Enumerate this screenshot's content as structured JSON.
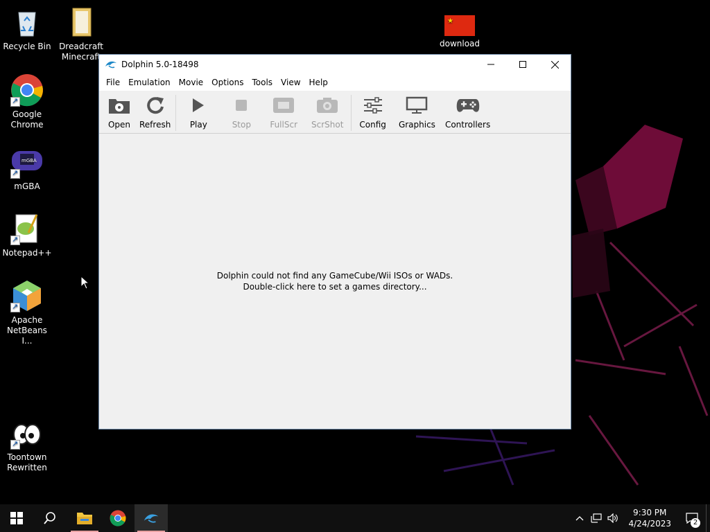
{
  "desktop": {
    "icons": [
      {
        "label": "Recycle Bin"
      },
      {
        "label": "Dreadcraft Minecraft"
      },
      {
        "label": "download"
      },
      {
        "label": "Google Chrome"
      },
      {
        "label": "mGBA"
      },
      {
        "label": "Notepad++"
      },
      {
        "label": "Apache NetBeans I..."
      },
      {
        "label": "Toontown Rewritten"
      }
    ]
  },
  "window": {
    "title": "Dolphin 5.0-18498",
    "menu": [
      "File",
      "Emulation",
      "Movie",
      "Options",
      "Tools",
      "View",
      "Help"
    ],
    "toolbar": {
      "open": "Open",
      "refresh": "Refresh",
      "play": "Play",
      "stop": "Stop",
      "fullscr": "FullScr",
      "scrshot": "ScrShot",
      "config": "Config",
      "graphics": "Graphics",
      "controllers": "Controllers"
    },
    "empty_message_line1": "Dolphin could not find any GameCube/Wii ISOs or WADs.",
    "empty_message_line2": "Double-click here to set a games directory..."
  },
  "taskbar": {
    "time": "9:30 PM",
    "date": "4/24/2023",
    "notification_count": "2",
    "pinned": [
      "start-icon",
      "search-icon",
      "file-explorer-icon",
      "chrome-icon",
      "dolphin-icon"
    ]
  },
  "colors": {
    "accent_underline": "#e8a0a0",
    "window_bg": "#f0f0f0"
  }
}
